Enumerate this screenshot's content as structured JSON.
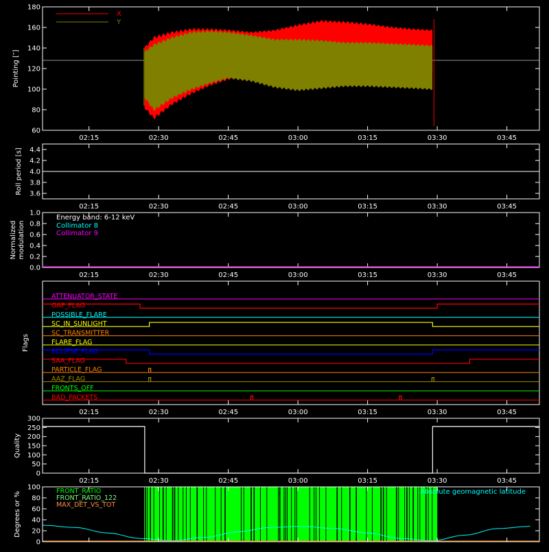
{
  "colors": {
    "bg": "#000000",
    "axis": "#ffffff",
    "red": "#ff0000",
    "olive": "#808000",
    "magenta": "#ff00ff",
    "cyan": "#00ffff",
    "yellow": "#ffff00",
    "orange": "#ff8000",
    "blue": "#0000ff",
    "green": "#00ff00",
    "aaz": "#a09000",
    "front122": "#80ff80",
    "maxdet": "#ff9040"
  },
  "chart_data": [
    {
      "type": "line",
      "id": "pointing",
      "ylabel": "Pointing [″]",
      "ylim": [
        60,
        180
      ],
      "yticks": [
        60,
        80,
        100,
        120,
        140,
        160,
        180
      ],
      "xlim": [
        "02:05",
        "03:52"
      ],
      "xticks": [
        "02:15",
        "02:30",
        "02:45",
        "03:00",
        "03:15",
        "03:30",
        "03:45"
      ],
      "legend": "top-left",
      "series": [
        {
          "name": "X",
          "color": "#ff0000",
          "x": [
            "02:27",
            "02:29",
            "02:33",
            "02:37",
            "02:41",
            "02:45",
            "02:50",
            "02:55",
            "03:00",
            "03:05",
            "03:10",
            "03:15",
            "03:20",
            "03:25",
            "03:29"
          ],
          "upper": [
            140,
            150,
            155,
            158,
            158,
            157,
            155,
            157,
            162,
            166,
            165,
            163,
            160,
            158,
            157
          ],
          "lower": [
            82,
            72,
            86,
            96,
            104,
            110,
            113,
            113,
            112,
            111,
            112,
            113,
            115,
            116,
            117
          ]
        },
        {
          "name": "Y",
          "color": "#808000",
          "x": [
            "02:27",
            "02:29",
            "02:33",
            "02:37",
            "02:41",
            "02:45",
            "02:50",
            "02:55",
            "03:00",
            "03:05",
            "03:10",
            "03:15",
            "03:20",
            "03:25",
            "03:29"
          ],
          "upper": [
            136,
            143,
            150,
            155,
            156,
            155,
            152,
            148,
            148,
            147,
            145,
            145,
            144,
            143,
            142
          ],
          "lower": [
            92,
            80,
            92,
            100,
            106,
            111,
            108,
            102,
            99,
            101,
            103,
            103,
            102,
            101,
            100
          ]
        }
      ],
      "reference_line": 128
    },
    {
      "type": "line",
      "id": "roll-period",
      "ylabel": "Roll period [s]",
      "ylim": [
        3.5,
        4.5
      ],
      "yticks": [
        3.6,
        3.8,
        4.0,
        4.2,
        4.4
      ],
      "xticks": [
        "02:15",
        "02:30",
        "02:45",
        "03:00",
        "03:15",
        "03:30",
        "03:45"
      ],
      "series": [
        {
          "x": [
            "02:05",
            "03:52"
          ],
          "y": [
            4.0,
            4.0
          ],
          "color": "#ffffff"
        }
      ]
    },
    {
      "type": "line",
      "id": "modulation",
      "ylabel_lines": [
        "Normalized",
        "modulation"
      ],
      "ylim": [
        0,
        1
      ],
      "yticks": [
        0.0,
        0.2,
        0.4,
        0.6,
        0.8,
        1.0
      ],
      "yticklabels": [
        "0.0",
        "0.2",
        "0.4",
        "0.6",
        "0.8",
        "1.0"
      ],
      "xticks": [
        "02:15",
        "02:30",
        "02:45",
        "03:00",
        "03:15",
        "03:30",
        "03:45"
      ],
      "legend": "top-left",
      "annotation": "Energy band: 6-12 keV",
      "series": [
        {
          "name": "Collimator 8",
          "color": "#00ffff",
          "x": [],
          "y": []
        },
        {
          "name": "Collimator 9",
          "color": "#ff00ff",
          "x": [
            "02:05",
            "03:52"
          ],
          "y": [
            0,
            0
          ]
        }
      ]
    },
    {
      "type": "line",
      "id": "flags",
      "ylabel": "Flags",
      "xticks": [
        "02:15",
        "02:30",
        "02:45",
        "03:00",
        "03:15",
        "03:30",
        "03:45"
      ],
      "series": [
        {
          "name": "ATTENUATOR_STATE",
          "color": "#ff00ff",
          "transitions": []
        },
        {
          "name": "GAP_FLAG",
          "color": "#ff0000",
          "transitions": [
            "02:26",
            "03:30"
          ],
          "initial": 1
        },
        {
          "name": "POSSIBLE_FLARE",
          "color": "#00ffff",
          "transitions": []
        },
        {
          "name": "SC_IN_SUNLIGHT",
          "color": "#ffff00",
          "transitions": [
            "02:28",
            "03:29"
          ],
          "initial": 0
        },
        {
          "name": "SC_TRANSMITTER",
          "color": "#ff8000",
          "transitions": []
        },
        {
          "name": "FLARE_FLAG",
          "color": "#ffff00",
          "transitions": []
        },
        {
          "name": "ECLIPSE_FLAG",
          "color": "#0000ff",
          "transitions": [
            "02:28",
            "03:29"
          ],
          "initial": 1
        },
        {
          "name": "SAA_FLAG",
          "color": "#ff0000",
          "transitions": [
            "02:23",
            "03:37"
          ],
          "initial": 1
        },
        {
          "name": "PARTICLE_FLAG",
          "color": "#ff8000",
          "spikes": [
            "02:28"
          ]
        },
        {
          "name": "AAZ_FLAG",
          "color": "#a09000",
          "spikes": [
            "02:28",
            "03:29"
          ]
        },
        {
          "name": "FRONTS_OFF",
          "color": "#00ff00",
          "transitions": []
        },
        {
          "name": "BAD_PACKETS",
          "color": "#ff0000",
          "spikes": [
            "02:50",
            "03:22"
          ]
        }
      ]
    },
    {
      "type": "line",
      "id": "quality",
      "ylabel": "Quality",
      "ylim": [
        0,
        300
      ],
      "yticks": [
        0,
        50,
        100,
        150,
        200,
        250,
        300
      ],
      "xticks": [
        "02:15",
        "02:30",
        "02:45",
        "03:00",
        "03:15",
        "03:30",
        "03:45"
      ],
      "series": [
        {
          "color": "#ffffff",
          "x": [
            "02:05",
            "02:27",
            "02:27",
            "03:29",
            "03:29",
            "03:52"
          ],
          "y": [
            255,
            255,
            0,
            0,
            255,
            255
          ]
        }
      ]
    },
    {
      "type": "line",
      "id": "ratios",
      "ylabel": "Degrees or %",
      "ylim": [
        0,
        100
      ],
      "yticks": [
        0,
        20,
        40,
        60,
        80,
        100
      ],
      "legend": "top-left",
      "right_label": "Absolute geomagnetic latitude",
      "series": [
        {
          "name": "FRONT_RATIO",
          "color": "#00ff00",
          "x": [
            "02:26",
            "03:30"
          ],
          "y": [
            100,
            100
          ]
        },
        {
          "name": "FRONT_RATIO_122",
          "color": "#80ff80",
          "x": [],
          "y": []
        },
        {
          "name": "MAX_DET_VS_TOT",
          "color": "#ff9040",
          "x": [],
          "y": []
        },
        {
          "name": "Absolute geomagnetic latitude",
          "color": "#00ffff",
          "x": [
            "02:05",
            "02:12",
            "02:19",
            "02:26",
            "02:33",
            "02:40",
            "02:47",
            "02:54",
            "03:01",
            "03:08",
            "03:15",
            "03:22",
            "03:29",
            "03:36",
            "03:43",
            "03:50"
          ],
          "y": [
            30,
            26,
            16,
            6,
            2,
            8,
            18,
            26,
            28,
            24,
            16,
            6,
            2,
            12,
            24,
            28
          ]
        }
      ]
    }
  ]
}
